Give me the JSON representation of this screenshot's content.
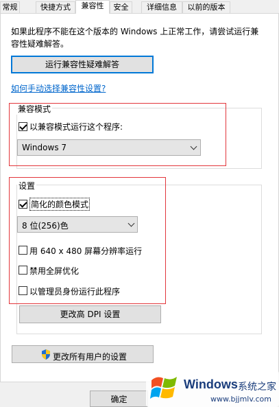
{
  "tabs": [
    "常规",
    "快捷方式",
    "兼容性",
    "安全",
    "详细信息",
    "以前的版本"
  ],
  "intro_text": "如果此程序不能在这个版本的 Windows 上正常工作，请尝试运行兼容性疑难解答。",
  "troubleshoot_button": "运行兼容性疑难解答",
  "manual_link": "如何手动选择兼容性设置?",
  "compat_group": {
    "title": "兼容模式",
    "checkbox_label": "以兼容模式运行这个程序:",
    "checked": true,
    "selected_os": "Windows 7"
  },
  "settings_group": {
    "title": "设置",
    "reduced_color": {
      "label": "简化的颜色模式",
      "checked": true
    },
    "color_select": "8 位(256)色",
    "res_640": {
      "label": "用 640 x 480 屏幕分辨率运行",
      "checked": false
    },
    "disable_fullscreen": {
      "label": "禁用全屏优化",
      "checked": false
    },
    "run_as_admin": {
      "label": "以管理员身份运行此程序",
      "checked": false
    },
    "dpi_button": "更改高 DPI 设置"
  },
  "all_users_button": "更改所有用户的设置",
  "ok_button": "确定",
  "watermark": {
    "brand": "Windows",
    "suffix": "系统之家",
    "url": "www.bjjmlv.com"
  },
  "colors": {
    "accent": "#0078d7",
    "link": "#0066cc",
    "highlight_box": "#e2353a"
  }
}
